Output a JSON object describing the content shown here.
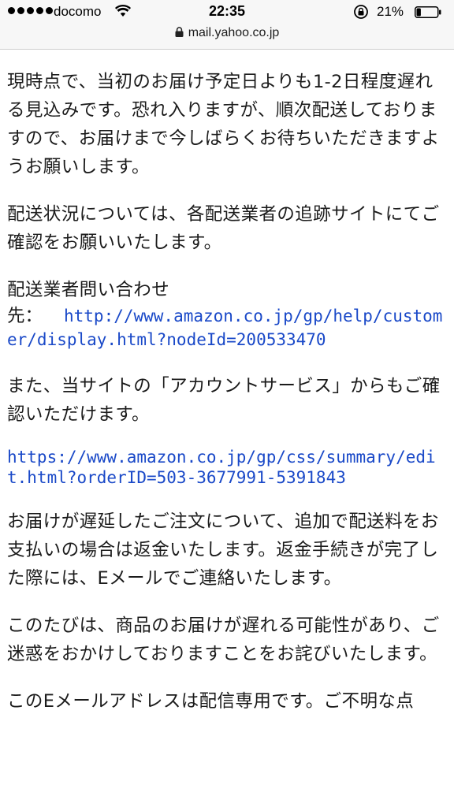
{
  "status_bar": {
    "carrier": "docomo",
    "time": "22:35",
    "battery_percent": "21%",
    "battery_level": 0.21
  },
  "address_bar": {
    "url": "mail.yahoo.co.jp"
  },
  "email": {
    "p1": "現時点で、当初のお届け予定日よりも1-2日程度遅れる見込みです。恐れ入りますが、順次配送しておりますので、お届けまで今しばらくお待ちいただきますようお願いします。",
    "p2": "配送状況については、各配送業者の追跡サイトにてご確認をお願いいたします。",
    "contact_label": "配送業者問い合わせ",
    "contact_prefix": "先：",
    "contact_link": "http://www.amazon.co.jp/gp/help/customer/display.html?nodeId=200533470",
    "p3": "また、当サイトの「アカウントサービス」からもご確認いただけます。",
    "account_link": "https://www.amazon.co.jp/gp/css/summary/edit.html?orderID=503-3677991-5391843",
    "p4": "お届けが遅延したご注文について、追加で配送料をお支払いの場合は返金いたします。返金手続きが完了した際には、Eメールでご連絡いたします。",
    "p5": "このたびは、商品のお届けが遅れる可能性があり、ご迷惑をおかけしておりますことをお詫びいたします。",
    "p6": "このEメールアドレスは配信専用です。ご不明な点"
  },
  "colors": {
    "link": "#1a49c8",
    "text": "#1b1b1b",
    "bar_background": "#f7f7f7"
  },
  "icons": [
    "signal-dots-icon",
    "wifi-icon",
    "rotation-lock-icon",
    "battery-icon",
    "padlock-icon"
  ]
}
